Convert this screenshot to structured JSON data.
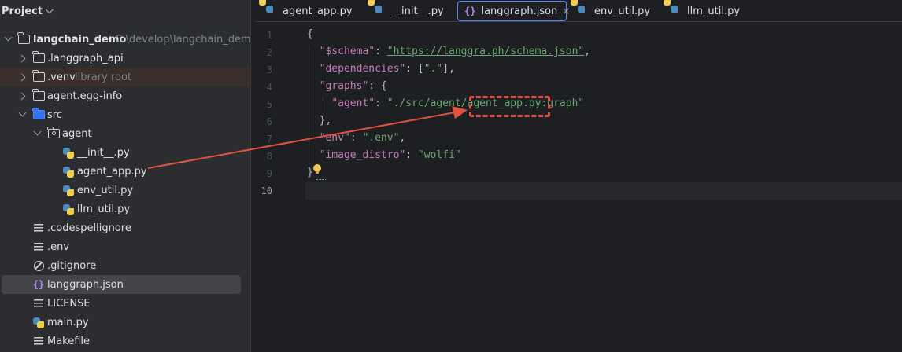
{
  "project": {
    "title": "Project",
    "root": {
      "name": "langchain_demo",
      "path": "C:\\develop\\langchain_demo"
    },
    "items": [
      {
        "label": ".langgraph_api"
      },
      {
        "label": ".venv",
        "hint": "library root"
      },
      {
        "label": "agent.egg-info"
      },
      {
        "label": "src"
      },
      {
        "label": "agent"
      },
      {
        "label": "__init__.py"
      },
      {
        "label": "agent_app.py"
      },
      {
        "label": "env_util.py"
      },
      {
        "label": "llm_util.py"
      },
      {
        "label": ".codespellignore"
      },
      {
        "label": ".env"
      },
      {
        "label": ".gitignore"
      },
      {
        "label": "langgraph.json"
      },
      {
        "label": "LICENSE"
      },
      {
        "label": "main.py"
      },
      {
        "label": "Makefile"
      }
    ]
  },
  "tabs": [
    {
      "label": "agent_app.py"
    },
    {
      "label": "__init__.py"
    },
    {
      "label": "langgraph.json",
      "active": true,
      "close": "×"
    },
    {
      "label": "env_util.py"
    },
    {
      "label": "llm_util.py"
    }
  ],
  "editor": {
    "line_numbers": [
      "1",
      "2",
      "3",
      "4",
      "5",
      "6",
      "7",
      "8",
      "9",
      "10"
    ],
    "code": {
      "l1": "{",
      "schema_key": "\"$schema\"",
      "schema_val": "\"https://langgra.ph/schema.json\"",
      "dep_key": "\"dependencies\"",
      "dep_val": "\".\"",
      "graphs_key": "\"graphs\"",
      "agent_key": "\"agent\"",
      "agent_val": "\"./src/agent/agent_app.py:graph\"",
      "close_graphs": "},",
      "env_key": "\"env\"",
      "env_val": "\".env\"",
      "distro_key": "\"image_distro\"",
      "distro_val": "\"wolfi\"",
      "l9": "}"
    }
  },
  "colors": {
    "annotation": "#e0533f",
    "accent": "#548af7"
  }
}
